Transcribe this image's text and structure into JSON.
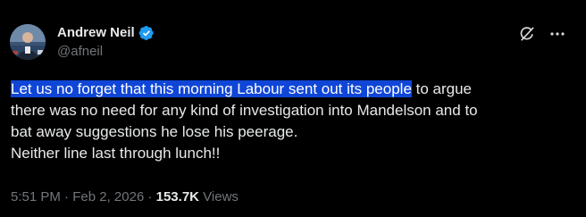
{
  "author": {
    "display_name": "Andrew Neil",
    "handle": "@afneil",
    "verified": true
  },
  "tweet": {
    "highlighted_text": "Let us no forget that this morning Labour sent out its people",
    "line1_rest": " to argue",
    "line2": "there was no need for any kind of investigation into Mandelson and to",
    "line3": "bat away suggestions he lose his peerage.",
    "line4": "Neither line last through lunch!!"
  },
  "meta": {
    "time": "5:51 PM",
    "sep1": " · ",
    "date": "Feb 2, 2026",
    "sep2": " · ",
    "views_count": "153.7K",
    "views_label": " Views"
  },
  "icons": {
    "verified": "verified-badge-icon",
    "grok": "grok-icon",
    "more": "more-icon"
  },
  "colors": {
    "background": "#000000",
    "text": "#e7e9ea",
    "secondary": "#71767b",
    "verified_blue": "#1d9bf0",
    "selection": "#0f46d8"
  }
}
